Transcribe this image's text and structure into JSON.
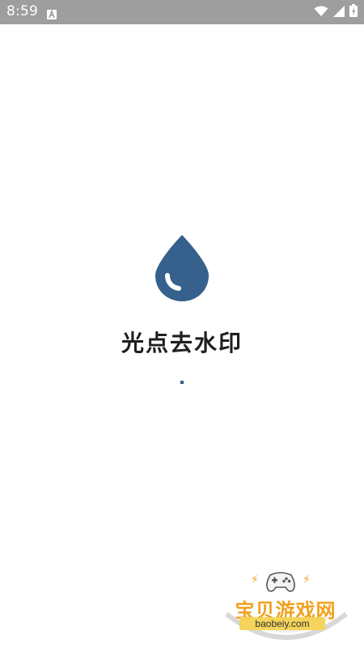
{
  "status_bar": {
    "time": "8:59",
    "notification_icon": "android-a-icon",
    "icons": [
      "wifi-icon",
      "signal-icon",
      "battery-icon"
    ],
    "background": "#9e9e9e"
  },
  "splash": {
    "title": "光点去水印",
    "logo_icon": "water-drop-icon",
    "logo_color": "#36618c",
    "loading_indicator": "loading-dot"
  },
  "watermark": {
    "title": "宝贝游戏网",
    "domain": "baobeiy.com",
    "icon": "gamepad-icon",
    "accent": "#f0a21d"
  }
}
